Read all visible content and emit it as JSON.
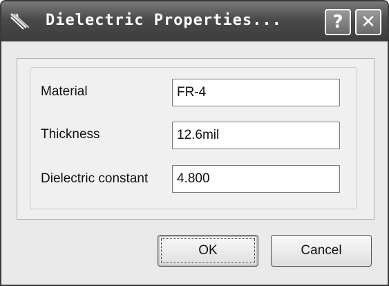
{
  "window": {
    "title": "Dielectric Properties...",
    "help_icon": "?",
    "close_icon": "✕"
  },
  "fields": [
    {
      "label": "Material",
      "value": "FR-4"
    },
    {
      "label": "Thickness",
      "value": "12.6mil"
    },
    {
      "label": "Dielectric constant",
      "value": "4.800"
    }
  ],
  "buttons": {
    "ok": "OK",
    "cancel": "Cancel"
  }
}
